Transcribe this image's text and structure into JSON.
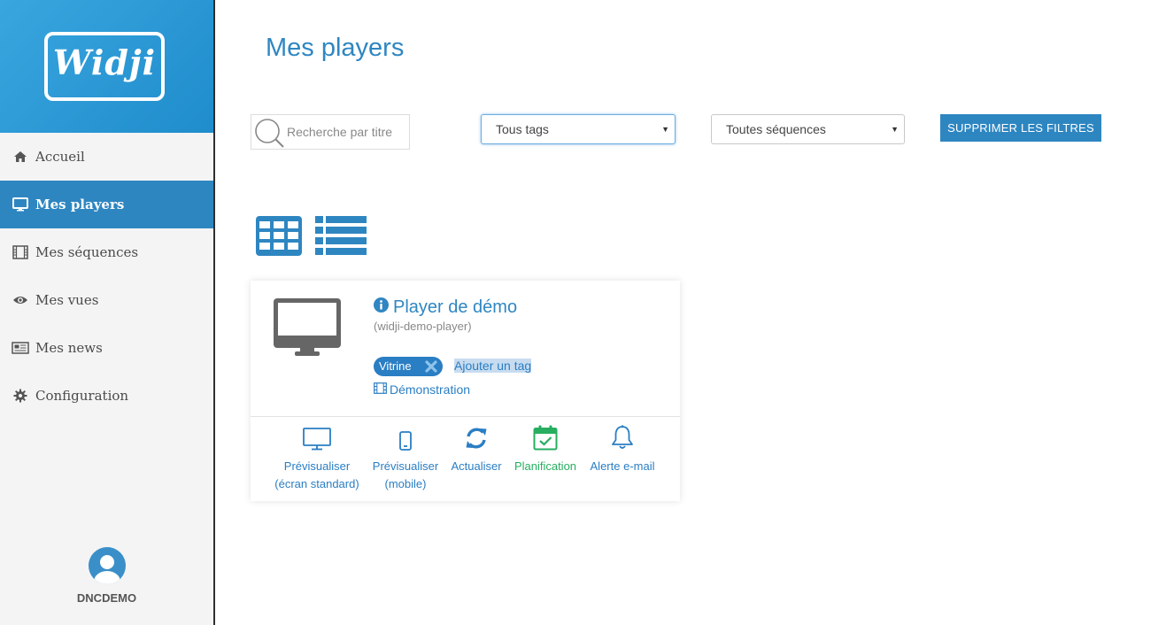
{
  "brand": {
    "logo_text": "Widji"
  },
  "sidebar": {
    "items": [
      {
        "label": "Accueil",
        "icon": "home-icon",
        "active": false
      },
      {
        "label": "Mes players",
        "icon": "monitor-icon",
        "active": true
      },
      {
        "label": "Mes séquences",
        "icon": "film-icon",
        "active": false
      },
      {
        "label": "Mes vues",
        "icon": "eye-icon",
        "active": false
      },
      {
        "label": "Mes news",
        "icon": "newspaper-icon",
        "active": false
      },
      {
        "label": "Configuration",
        "icon": "gear-icon",
        "active": false
      }
    ],
    "user": {
      "name": "DNCDEMO"
    }
  },
  "page": {
    "title": "Mes players"
  },
  "filters": {
    "search_placeholder": "Recherche par titre",
    "tags_value": "Tous tags",
    "sequences_value": "Toutes séquences",
    "clear_label": "SUPPRIMER LES FILTRES"
  },
  "player": {
    "name": "Player de démo",
    "slug": "(widji-demo-player)",
    "tag": "Vitrine",
    "add_tag_label": "Ajouter un tag",
    "sequence": "Démonstration",
    "actions": {
      "preview_standard": {
        "line1": "Prévisualiser",
        "line2": "(écran standard)"
      },
      "preview_mobile": {
        "line1": "Prévisualiser",
        "line2": "(mobile)"
      },
      "refresh": {
        "line1": "Actualiser"
      },
      "schedule": {
        "line1": "Planification"
      },
      "email_alert": {
        "line1": "Alerte e-mail"
      }
    }
  },
  "colors": {
    "accent": "#2e86c1",
    "title": "#2f86c2",
    "green": "#27ae60",
    "sidebar_bg": "#f4f4f4"
  }
}
